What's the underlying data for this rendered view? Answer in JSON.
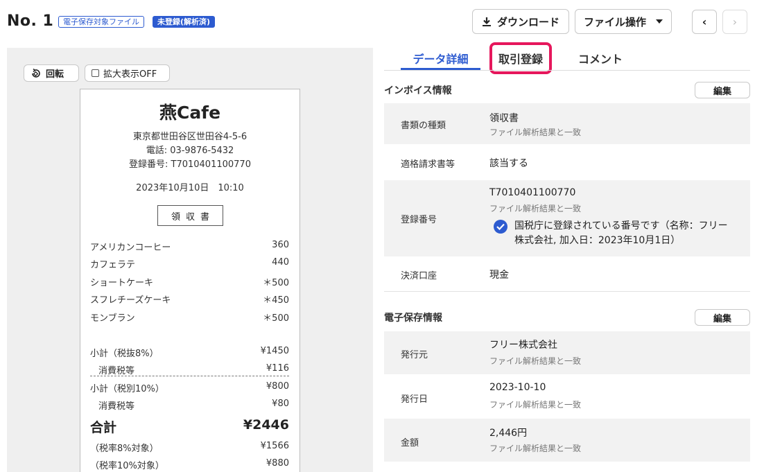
{
  "header": {
    "doc_no": "No. 1",
    "tag_storage": "電子保存対象ファイル",
    "tag_status": "未登録(解析済)",
    "download_label": "ダウンロード",
    "file_ops_label": "ファイル操作",
    "prev_icon": "‹",
    "next_icon": "›"
  },
  "preview": {
    "rotate_label": "回転",
    "zoom_label": "拡大表示OFF"
  },
  "receipt": {
    "shop": "燕Cafe",
    "address": "東京都世田谷区世田谷4-5-6",
    "phone": "電話: 03-9876-5432",
    "reg_no": "登録番号: T7010401100770",
    "datetime": "2023年10月10日　10:10",
    "title": "領収書",
    "items": [
      {
        "name": "アメリカンコーヒー",
        "price": "360"
      },
      {
        "name": "カフェラテ",
        "price": "440"
      },
      {
        "name": "ショートケーキ",
        "price": "＊500"
      },
      {
        "name": "スフレチーズケーキ",
        "price": "＊450"
      },
      {
        "name": "モンブラン",
        "price": "＊500"
      }
    ],
    "subtotals": [
      {
        "name": "小計（税抜8%）",
        "price": "¥1450"
      },
      {
        "name": "消費税等",
        "price": "¥116"
      },
      {
        "name": "小計（税別10%）",
        "price": "¥800"
      },
      {
        "name": "消費税等",
        "price": "¥80"
      }
    ],
    "total_label": "合計",
    "total_value": "¥2446",
    "breakdown": [
      {
        "name": "（税率8%対象）",
        "price": "¥1566"
      },
      {
        "name": "（税率10%対象）",
        "price": "¥880"
      }
    ]
  },
  "tabs": {
    "detail": "データ詳細",
    "register": "取引登録",
    "comment": "コメント"
  },
  "invoice": {
    "title": "インボイス情報",
    "edit": "編集",
    "doc_type_label": "書類の種類",
    "doc_type_value": "領収書",
    "doc_type_sub": "ファイル解析結果と一致",
    "qualified_label": "適格請求書等",
    "qualified_value": "該当する",
    "regno_label": "登録番号",
    "regno_value": "T7010401100770",
    "regno_sub": "ファイル解析結果と一致",
    "regno_verify": "国税庁に登録されている番号です（名称：フリー株式会社, 加入日：2023年10月1日）",
    "payment_label": "決済口座",
    "payment_value": "現金"
  },
  "storage": {
    "title": "電子保存情報",
    "edit": "編集",
    "issuer_label": "発行元",
    "issuer_value": "フリー株式会社",
    "issuer_sub": "ファイル解析結果と一致",
    "date_label": "発行日",
    "date_value": "2023-10-10",
    "date_sub": "ファイル解析結果と一致",
    "amount_label": "金額",
    "amount_value": "2,446円",
    "amount_sub": "ファイル解析結果と一致"
  },
  "colors": {
    "accent": "#2d5bd0",
    "highlight": "#e6175c"
  }
}
